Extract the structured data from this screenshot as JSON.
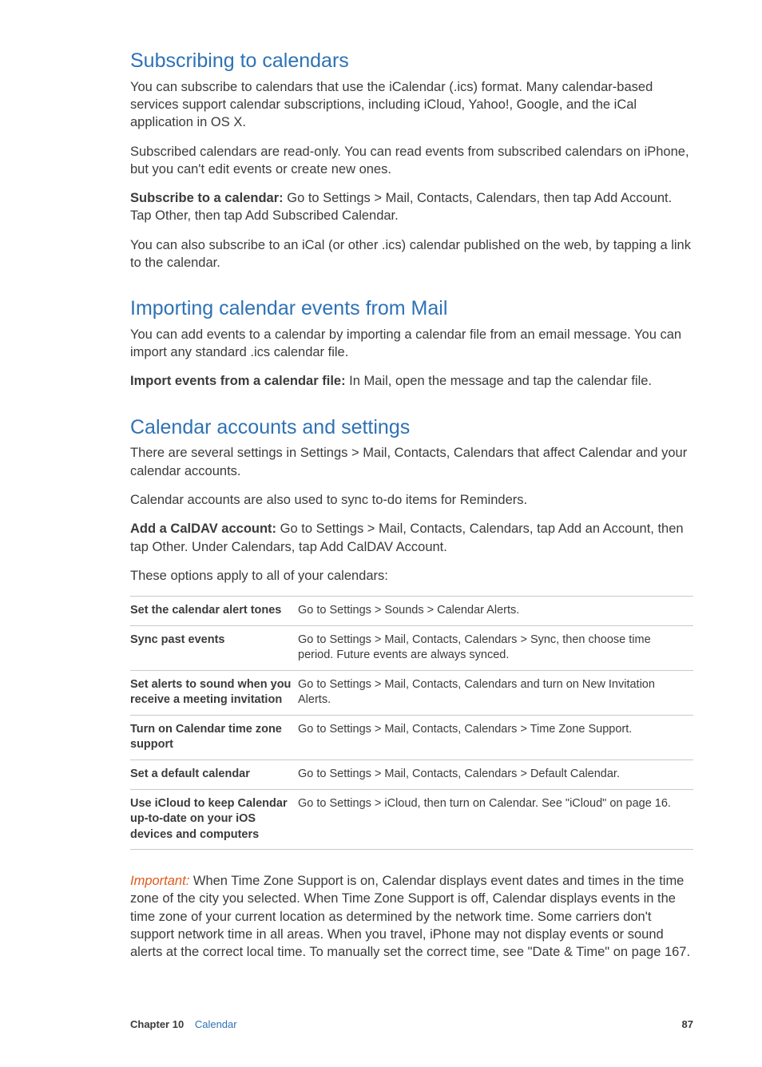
{
  "sections": {
    "subscribing": {
      "heading": "Subscribing to calendars",
      "p1": "You can subscribe to calendars that use the iCalendar (.ics) format. Many calendar-based services support calendar subscriptions, including iCloud, Yahoo!, Google, and the iCal application in OS X.",
      "p2": "Subscribed calendars are read-only. You can read events from subscribed calendars on iPhone, but you can't edit events or create new ones.",
      "p3_bold": "Subscribe to a calendar:  ",
      "p3_rest": "Go to Settings > Mail, Contacts, Calendars, then tap Add Account. Tap Other, then tap Add Subscribed Calendar.",
      "p4": "You can also subscribe to an iCal (or other .ics) calendar published on the web, by tapping a link to the calendar."
    },
    "importing": {
      "heading": "Importing calendar events from Mail",
      "p1": "You can add events to a calendar by importing a calendar file from an email message. You can import any standard .ics calendar file.",
      "p2_bold": "Import events from a calendar file:  ",
      "p2_rest": "In Mail, open the message and tap the calendar file."
    },
    "settings": {
      "heading": "Calendar accounts and settings",
      "p1": "There are several settings in Settings > Mail, Contacts, Calendars that affect Calendar and your calendar accounts.",
      "p2": "Calendar accounts are also used to sync to-do items for Reminders.",
      "p3_bold": "Add a CalDAV account:  ",
      "p3_rest": "Go to Settings > Mail, Contacts, Calendars, tap Add an Account, then tap Other. Under Calendars, tap Add CalDAV Account.",
      "p4": "These options apply to all of your calendars:",
      "table": [
        {
          "left": "Set the calendar alert tones",
          "right": "Go to Settings > Sounds > Calendar Alerts."
        },
        {
          "left": "Sync past events",
          "right": "Go to Settings > Mail, Contacts, Calendars > Sync, then choose time period. Future events are always synced."
        },
        {
          "left": "Set alerts to sound when you receive a meeting invitation",
          "right": "Go to Settings > Mail, Contacts, Calendars and turn on New Invitation Alerts."
        },
        {
          "left": "Turn on Calendar time zone support",
          "right": "Go to Settings > Mail, Contacts, Calendars > Time Zone Support."
        },
        {
          "left": "Set a default calendar",
          "right": "Go to Settings > Mail, Contacts, Calendars > Default Calendar."
        },
        {
          "left": "Use iCloud to keep Calendar up-to-date on your iOS devices and computers",
          "right": "Go to Settings > iCloud, then turn on Calendar. See \"iCloud\" on page 16."
        }
      ],
      "important_label": "Important:  ",
      "important_text": "When Time Zone Support is on, Calendar displays event dates and times in the time zone of the city you selected. When Time Zone Support is off, Calendar displays events in the time zone of your current location as determined by the network time. Some carriers don't support network time in all areas. When you travel, iPhone may not display events or sound alerts at the correct local time. To manually set the correct time, see \"Date & Time\" on page 167."
    }
  },
  "footer": {
    "chapter_label": "Chapter 10",
    "chapter_name": "Calendar",
    "page": "87"
  }
}
